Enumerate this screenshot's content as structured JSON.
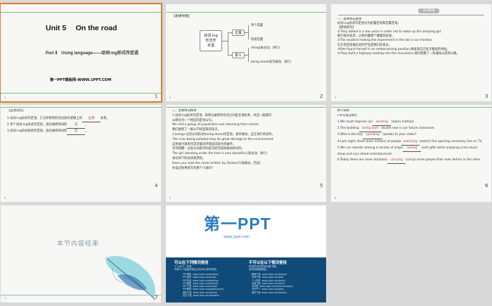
{
  "slides": [
    {
      "number": "1",
      "title": "Unit 5　 On the road",
      "subtitle": "Part Ⅱ　Using language——动词-ing形式作定语",
      "source": "第一PPT模板网-WWW.1PPT.COM",
      "page": "1"
    },
    {
      "number": "2",
      "header": "【思维导图】",
      "center": "动词-ing\n形式作\n定语",
      "branches": [
        "位置",
        "意义"
      ],
      "leaves": [
        "单个前置",
        "短语后置",
        "doing(表主动、进行)",
        "being done(表示被动、进行)"
      ],
      "page": "2"
    },
    {
      "number": "3",
      "badge": "语法精讲",
      "lines": [
        "一、基本特征感悟",
        "动词-ing形式作定语分为前置定语和后置定语。",
        "【感悟例句】",
        "①They talked in a low voice in order not to wake up the sleeping girl.",
        "他们低声说话，以免吵醒那个睡着的女孩。",
        "②The student making the experiment in the lab is our monitor.",
        "在实验室里做实验的学生是我们的班长。",
        "③She found herself in an embarrassing position.她发现自己处于尴尬的地位。",
        "④They built a highway leading into the mountains.他们修建了一条通往山里的公路。"
      ],
      "page": "3"
    },
    {
      "number": "4",
      "heading": "【自我总结】",
      "lines": [
        "1.动词-ing形式作定语，它与所修饰的名词具有逻辑上的",
        "2.单个动词-ing形式作定语，放在被修饰词的",
        "3.动词-ing形式短语作定语，放在被修饰词的"
      ],
      "tails": [
        "关系。",
        "。",
        "。"
      ],
      "answers": [
        "主谓",
        "前",
        "后"
      ],
      "page": "4"
    },
    {
      "number": "5",
      "lines": [
        "二、主要用法精讲",
        "1.动词-ing形式作定语，表明与被修饰名词之间是主谓关系，并且一般都可",
        "  以转化为一个相应的定语从句。",
        "  We met a group of pupils(who are) returning from school.",
        "  我们碰到了一群从学校回来的孩子。",
        "2.being+过去分词形式(being done)作定语，表示被动、正在进行的动作。",
        "  The river being polluted may do great damage to the environment.",
        "  这条被污染的河流可能对环境造成很大的破坏。",
        "  名师提醒：过去分词表示的是已经完成或被动的动作。",
        "  The girl standing under the tree is very beautiful.(表主动，进行)",
        "  站在树下的女孩很漂亮。",
        "  Have you read the novel written by Dickens?(表被动，完成)",
        "  你读过狄更斯写的那个小说吗？"
      ],
      "page": "5"
    },
    {
      "number": "6",
      "heading": "即学即练",
      "sub": "Ⅰ.单句语法填空",
      "items": [
        {
          "pre": "1.We must improve our",
          "ans": "working",
          "post": "(work) method."
        },
        {
          "pre": "2.The building",
          "ans": "being built",
          "post": "(build) now is our future classroom."
        },
        {
          "pre": "3.Who is the boy",
          "ans": "speaking",
          "post": "(speak) to your sister?"
        },
        {
          "pre": "4.Last night, there were millions of people",
          "ans": "watching",
          "post": "(watch) the opening ceremony live on TV."
        },
        {
          "pre": "5.We can wander among a variety of shops",
          "ans": "selling",
          "post": "(sell) gifts while enjoying a live music show and nice street entertainment."
        },
        {
          "pre": "6.Today there are more airplanes",
          "ans": "carrying",
          "post": "(carry) more people than ever before in the skies."
        }
      ],
      "page": "6"
    },
    {
      "number": "7",
      "title": "本节内容结束",
      "page": "7"
    },
    {
      "number": "8",
      "logo": "第一PPT",
      "url": "www.1ppt.com",
      "left_heading": "可以在下列情况使用",
      "right_heading": "不可以在以下情况使用",
      "left_text": [
        "个人学习、研究。",
        "任何个人或者任何企业均可以发布有偿。"
      ],
      "right_text": [
        "任何形式的在线付费下载。",
        "发布到其他网站。"
      ],
      "list_left": "PPT模板  www.1ppt.com/moban/\nPPT素材  www.1ppt.com/sucai/\nPPT背景  www.1ppt.com/beijing/\nPPT图表  www.1ppt.com/tubiao/\nPPT下载  www.1ppt.com/xiazai/\nPPT教程  www.1ppt.com/powerpoint/\n资料下载  www.1ppt.com/ziliao/\n范文下载  www.1ppt.com/fanwen/",
      "list_right": "教案下载  www.1ppt.com/jiaoan/\n字体下载  www.1ppt.com/ziti/\n个人简历  www.1ppt.com/jianli/\n试卷下载  www.1ppt.com/shiti/\n手抄报  www.1ppt.com/shouchaobao/\n节日PPT  www.1ppt.com/jieri/\n课件下载  www.1ppt.com/kejian/",
      "page": "8"
    }
  ],
  "colors": {
    "accent": "#e07b2c",
    "green_line": "#7cbf7a",
    "answer_red": "#c0392b",
    "logo_blue": "#2b7cc6",
    "footer_navy": "#0f4a78"
  }
}
